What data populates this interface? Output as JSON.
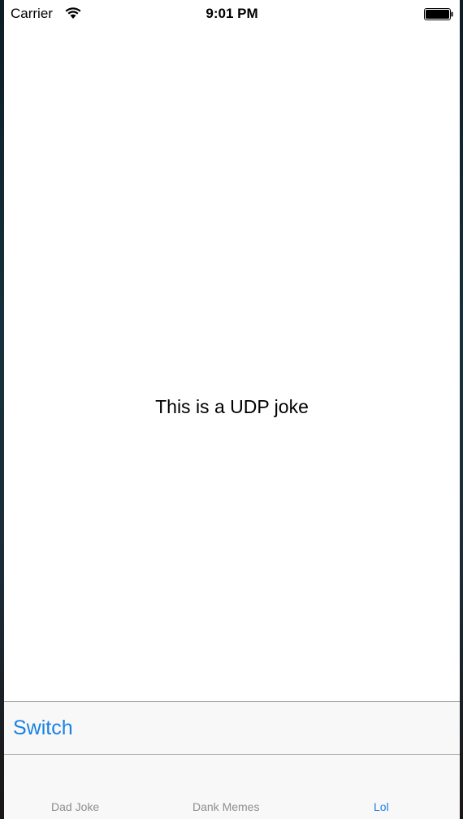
{
  "status_bar": {
    "carrier": "Carrier",
    "time": "9:01 PM",
    "wifi_icon": "wifi-icon",
    "battery_icon": "battery-icon"
  },
  "main": {
    "joke_text": "This is a UDP joke"
  },
  "toolbar": {
    "switch_label": "Switch"
  },
  "tab_bar": {
    "tabs": [
      {
        "label": "Dad Joke",
        "active": false
      },
      {
        "label": "Dank Memes",
        "active": false
      },
      {
        "label": "Lol",
        "active": true
      }
    ]
  },
  "colors": {
    "accent": "#1a82e2",
    "inactive_tab": "#8e8e93",
    "bar_background": "#f8f8f8"
  }
}
